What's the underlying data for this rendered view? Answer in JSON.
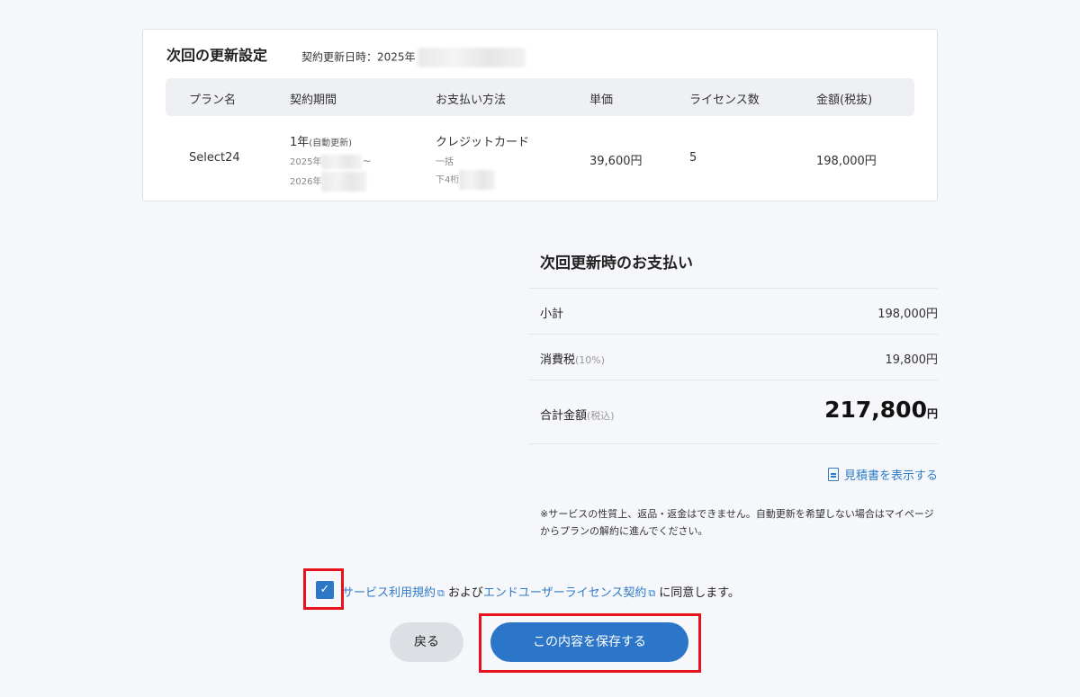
{
  "renewal": {
    "title": "次回の更新設定",
    "contract_date_label": "契約更新日時：2025年"
  },
  "table": {
    "headers": [
      "プラン名",
      "契約期間",
      "お支払い方法",
      "単価",
      "ライセンス数",
      "金額(税抜)"
    ],
    "row": {
      "plan": "Select24",
      "period_main": "1年",
      "period_auto": "(自動更新)",
      "period_start": "2025年",
      "period_tilde": "~",
      "period_end": "2026年",
      "payment_method": "クレジットカード",
      "payment_type": "一括",
      "card_last4_label": "下4桁",
      "unit_price": "39,600円",
      "licenses": "5",
      "amount": "198,000円"
    }
  },
  "summary": {
    "title": "次回更新時のお支払い",
    "subtotal_label": "小計",
    "subtotal_value": "198,000円",
    "tax_label": "消費税",
    "tax_rate": "(10%)",
    "tax_value": "19,800円",
    "total_label": "合計金額",
    "total_note": "(税込)",
    "total_value": "217,800",
    "total_unit": "円",
    "estimate_link": "見積書を表示する",
    "notice": "※サービスの性質上、返品・返金はできません。自動更新を希望しない場合はマイページからプランの解約に進んでください。"
  },
  "agreement": {
    "terms_link": "サービス利用規約",
    "and": "および",
    "eula_link": "エンドユーザーライセンス契約",
    "suffix": "に同意します。",
    "checked_mark": "✓"
  },
  "buttons": {
    "back": "戻る",
    "save": "この内容を保存する"
  },
  "icons": {
    "external_link": "⧉"
  },
  "colors": {
    "accent": "#2c76c9",
    "highlight": "#e6131d"
  }
}
